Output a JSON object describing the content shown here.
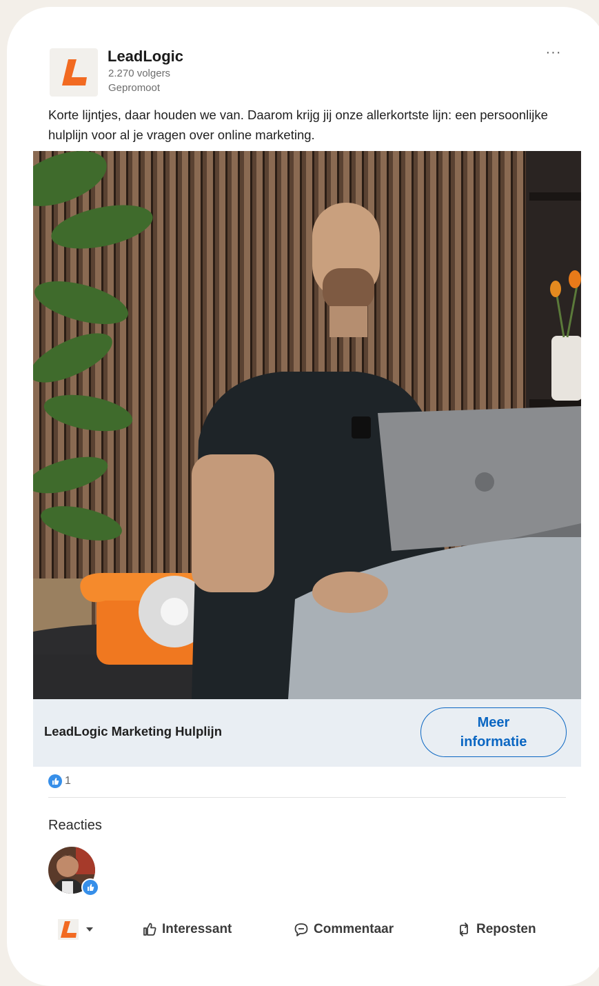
{
  "post": {
    "company_name": "LeadLogic",
    "followers": "2.270 volgers",
    "promoted_label": "Gepromoot",
    "more_label": "···",
    "text": "Korte lijntjes, daar houden we van. Daarom krijg jij onze allerkortste lijn: een persoonlijke hulplijn voor al je vragen over online marketing."
  },
  "cta": {
    "title": "LeadLogic Marketing Hulplijn",
    "button_line1": "Meer",
    "button_line2": "informatie"
  },
  "social": {
    "reaction_count": "1",
    "comments_heading": "Reacties"
  },
  "actions": {
    "like": "Interessant",
    "comment": "Commentaar",
    "repost": "Reposten"
  },
  "colors": {
    "brand_orange": "#f26a21",
    "link_blue": "#0a66c2",
    "like_blue": "#378fe9",
    "cta_background": "#e9eef3",
    "page_background": "#f3efe9"
  },
  "icons": {
    "logo": "leadlogic-l-logo",
    "more": "more-dots-icon",
    "like": "thumbs-up-icon",
    "comment": "comment-bubble-icon",
    "repost": "repost-arrows-icon",
    "dropdown": "caret-down-icon"
  }
}
